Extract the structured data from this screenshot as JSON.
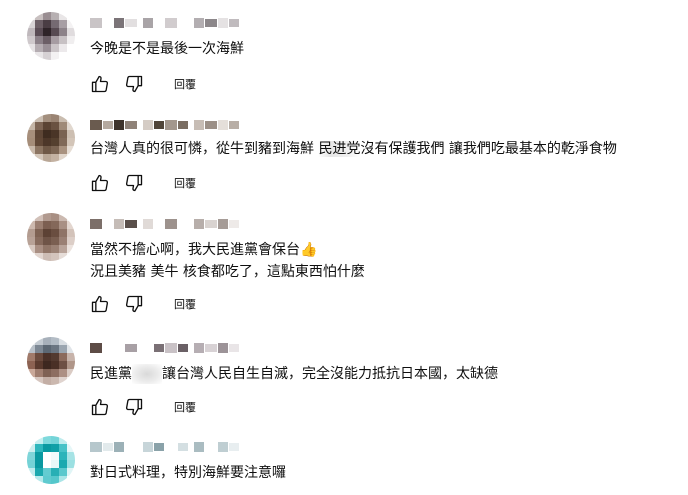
{
  "comments": [
    {
      "author_hidden": true,
      "text": "今晚是不是最後一次海鮮",
      "text2": "",
      "reply_label": "回覆",
      "avatar_colors": [
        "#f2f2f2",
        "#c8c0c0",
        "#9a8e92",
        "#b7b0b2",
        "#e9e6e7",
        "#ffffff",
        "#d8d4d6",
        "#6c5f66",
        "#4a3d44",
        "#756a72",
        "#a79ea4",
        "#f4f2f3",
        "#bfb8bc",
        "#5a4c55",
        "#2f2429",
        "#574a52",
        "#8c8289",
        "#e0dcde",
        "#cfc9cc",
        "#8b8088",
        "#6b5e66",
        "#a69ca2",
        "#c7c1c4",
        "#f0eeef",
        "#e6e3e5",
        "#b5adb2",
        "#9a9097",
        "#cbc5c8",
        "#ece9eb",
        "#ffffff",
        "#ffffff",
        "#e9e6e8",
        "#d6d1d4",
        "#f3f1f2",
        "#ffffff",
        "#ffffff"
      ]
    },
    {
      "author_hidden": true,
      "text_before": "台灣人真的很可憐，從牛到豬到海鮮 ",
      "text_mid": "民进党",
      "text_after": "沒有保護我們 讓我們吃最基本的乾淨食物",
      "reply_label": "回覆",
      "avatar_colors": [
        "#e8e2dc",
        "#cbbfb3",
        "#a38f7e",
        "#9a8473",
        "#c9bcaf",
        "#efeae5",
        "#c5b6a7",
        "#7d6554",
        "#5b4434",
        "#6a5241",
        "#9f8a78",
        "#e1d8cf",
        "#a78f7c",
        "#5e4636",
        "#3f2c20",
        "#4a3527",
        "#7a6352",
        "#cdbfb2",
        "#a58d79",
        "#614837",
        "#4d3729",
        "#55402f",
        "#806958",
        "#d3c5b8",
        "#c9b9aa",
        "#8c7562",
        "#6f5846",
        "#7c6553",
        "#a9927f",
        "#e6ddd4",
        "#f0ebe6",
        "#d5c8bb",
        "#b9a796",
        "#c4b2a2",
        "#e1d6cb",
        "#f7f4f1"
      ]
    },
    {
      "author_hidden": true,
      "text": "當然不擔心啊，我大民進黨會保台👍",
      "text2": "況且美豬 美牛 核食都吃了，這點東西怕什麼",
      "reply_label": "回覆",
      "avatar_colors": [
        "#efe9e6",
        "#d1c0b8",
        "#b19a8f",
        "#a88f83",
        "#cbb9b0",
        "#f3eeeb",
        "#cdb9ae",
        "#9b7f71",
        "#7c5f51",
        "#84685a",
        "#a99084",
        "#e3d6cf",
        "#b39c90",
        "#7e6253",
        "#5d4235",
        "#6a4e40",
        "#8f7467",
        "#d3c3ba",
        "#b8a297",
        "#876b5d",
        "#6f5447",
        "#7a5f51",
        "#9a8074",
        "#dccec7",
        "#d7c8c0",
        "#a98f83",
        "#917668",
        "#9b8275",
        "#b9a49a",
        "#ece3de",
        "#f5f1ef",
        "#e2d6d0",
        "#cdbdb5",
        "#d3c4bc",
        "#e6ddd8",
        "#faf8f7"
      ]
    },
    {
      "author_hidden": true,
      "text_before": "民進黨",
      "text_mid": "",
      "text_after": "讓台灣人民自生自滅，完全沒能力抵抗日本國，太缺德",
      "reply_label": "回覆",
      "avatar_colors": [
        "#e3e6ea",
        "#c5ccd3",
        "#a7b0ba",
        "#b3bcc5",
        "#d8dde2",
        "#f1f3f5",
        "#b9c1c9",
        "#7d8894",
        "#5c6874",
        "#6b7682",
        "#9aa5b0",
        "#e0e4e8",
        "#a07a6a",
        "#6a4a3d",
        "#4a3128",
        "#533a30",
        "#8b6a5c",
        "#c7b3aa",
        "#8c6252",
        "#5a3a2e",
        "#3e2820",
        "#4a3026",
        "#6d4f43",
        "#b09689",
        "#caa99a",
        "#a07e70",
        "#7f6154",
        "#8d6e61",
        "#ad9084",
        "#dacbc4",
        "#eee6e2",
        "#d6c6bf",
        "#c3aea5",
        "#cbb8af",
        "#e0d4cf",
        "#f6f2f0"
      ]
    },
    {
      "author_hidden": true,
      "text": "對日式料理，特別海鮮要注意囉",
      "text2": "",
      "reply_label": "",
      "avatar_colors": [
        "#ffffff",
        "#c7eff0",
        "#7fd9dc",
        "#74d4d8",
        "#bfeced",
        "#ffffff",
        "#cdeff0",
        "#2fb7bd",
        "#0a9aa1",
        "#10a0a7",
        "#47c2c7",
        "#e6f7f8",
        "#7fd5d9",
        "#0b9aa1",
        "#ffffff",
        "#f3fbfb",
        "#2db4ba",
        "#a6e3e5",
        "#75d2d6",
        "#0a98a0",
        "#ffffff",
        "#e8f7f8",
        "#1aa9b0",
        "#9be0e2",
        "#c1ecee",
        "#1ba8ae",
        "#64ccd1",
        "#27afb5",
        "#5bc8cd",
        "#e0f5f6",
        "#ffffff",
        "#b6e9eb",
        "#5fcacf",
        "#55c7cb",
        "#aae5e7",
        "#ffffff"
      ]
    }
  ],
  "authors": [
    [
      "#c9c4c6",
      "#ffffff",
      "#7b7478",
      "#e2dfe0",
      "#a9a4a7",
      "#ffffff",
      "#d1ccce",
      "#ffffff",
      "#b3aeb1",
      "#8c878a",
      "#e5e2e3",
      "#c0bbbe"
    ],
    [
      "#6a5b4f",
      "#b5a99f",
      "#3f342c",
      "#8f8278",
      "#d5ccc5",
      "#514539",
      "#a3978d",
      "#7a6d62",
      "#c7bdb5",
      "#9c9087",
      "#e5dfda",
      "#b8aea6"
    ],
    [
      "#7c6f69",
      "#ffffff",
      "#c5bcb7",
      "#5a4f4a",
      "#e0dad7",
      "#ffffff",
      "#9d928d",
      "#ffffff",
      "#b7aeaa",
      "#d9d3d0",
      "#a69c97",
      "#eeeae8"
    ],
    [
      "#5d4c46",
      "#ffffff",
      "#ffffff",
      "#a8a0a5",
      "#ffffff",
      "#7a7075",
      "#c9c2c6",
      "#6a6065",
      "#b6aeb3",
      "#d8d2d5",
      "#9c9398",
      "#e9e5e7"
    ],
    [
      "#b6c7cc",
      "#e2eaec",
      "#9cb1b7",
      "#ffffff",
      "#c7d5d9",
      "#8aa2a9",
      "#ffffff",
      "#d4dfe2",
      "#aabcc1",
      "#ffffff",
      "#bfced2",
      "#e8eef0"
    ]
  ]
}
